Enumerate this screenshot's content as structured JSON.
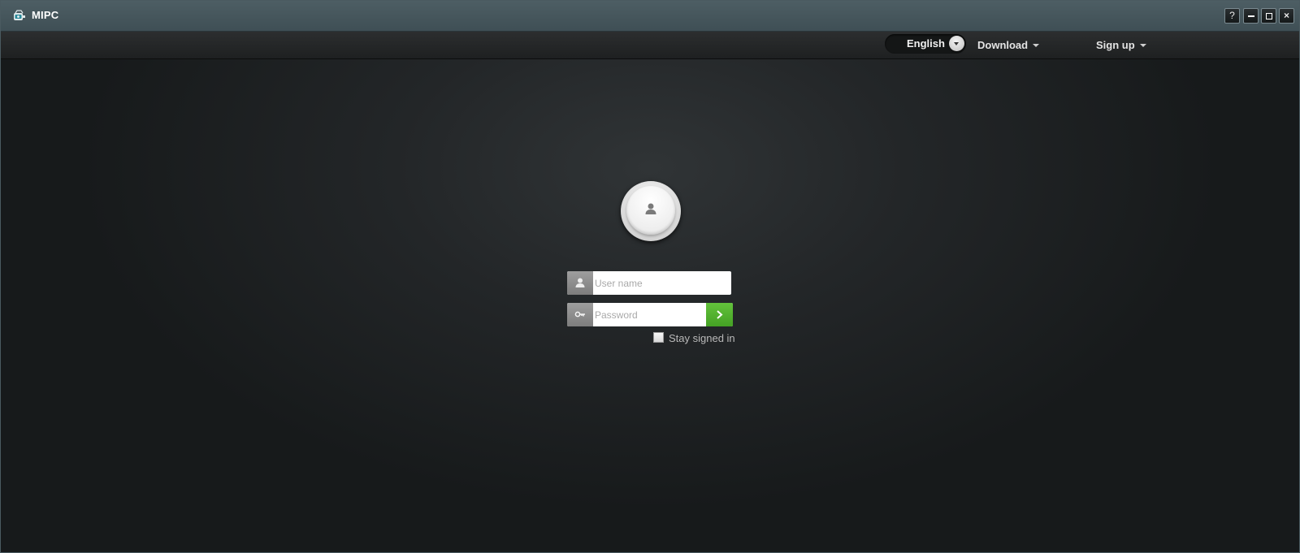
{
  "window": {
    "title": "MIPC",
    "app_icon": "camera-app-icon",
    "controls": {
      "help_label": "?",
      "minimize_icon": "minimize-icon",
      "maximize_icon": "maximize-icon",
      "close_label": "×"
    }
  },
  "nav": {
    "language": {
      "label": "English",
      "icon": "chevron-down-icon"
    },
    "download_label": "Download",
    "signup_label": "Sign up"
  },
  "login": {
    "avatar_icon": "user-icon",
    "username": {
      "placeholder": "User name",
      "value": "",
      "icon": "user-icon"
    },
    "password": {
      "placeholder": "Password",
      "value": "",
      "icon": "key-icon"
    },
    "submit_icon": "arrow-right-icon",
    "remember": {
      "label": "Stay signed in",
      "checked": false
    }
  },
  "colors": {
    "titlebar": "#4d5e64",
    "background": "#1b1d1e",
    "accent_green": "#52b22f",
    "field_icon_bg": "#8c8c8c"
  }
}
